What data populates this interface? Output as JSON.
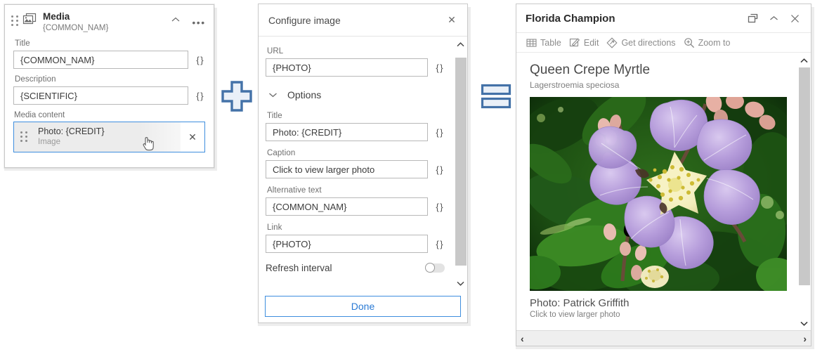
{
  "media_panel": {
    "header": {
      "icon": "media-image-icon",
      "title": "Media",
      "subtitle": "{COMMON_NAM}",
      "collapse_icon": "chevron-up-icon",
      "menu_icon": "ellipsis-icon",
      "drag_icon": "drag-handle-icon"
    },
    "fields": [
      {
        "label": "Title",
        "value": "{COMMON_NAM}",
        "expr_icon": "{ }"
      },
      {
        "label": "Description",
        "value": "{SCIENTIFIC}",
        "expr_icon": "{ }"
      }
    ],
    "media_content": {
      "label": "Media content",
      "item_title": "Photo: {CREDIT}",
      "item_subtitle": "Image",
      "remove_icon": "close-icon",
      "drag_icon": "drag-handle-icon",
      "cursor_icon": "pointer-hand-cursor",
      "selected_border_color": "#3e8ede"
    }
  },
  "operators": {
    "plus": {
      "icon": "plus-sign-glyph",
      "color": "#4472a8"
    },
    "equals": {
      "icon": "equals-sign-glyph",
      "color": "#4472a8"
    }
  },
  "configure_panel": {
    "title": "Configure image",
    "close_icon": "close-icon",
    "url_field": {
      "label": "URL",
      "value": "{PHOTO}",
      "expr_icon": "{ }"
    },
    "options_section": {
      "label": "Options",
      "chevron_icon": "chevron-down-icon",
      "expanded": true
    },
    "fields": [
      {
        "label": "Title",
        "value": "Photo: {CREDIT}",
        "expr_icon": "{ }"
      },
      {
        "label": "Caption",
        "value": "Click to view larger photo",
        "expr_icon": "{ }"
      },
      {
        "label": "Alternative text",
        "value": "{COMMON_NAM}",
        "expr_icon": "{ }"
      },
      {
        "label": "Link",
        "value": "{PHOTO}",
        "expr_icon": "{ }"
      }
    ],
    "refresh": {
      "label": "Refresh interval",
      "toggle_on": false,
      "toggle_icon": "switch-toggle-off"
    },
    "scrollbar": {
      "up_icon": "scroll-up-arrow",
      "down_icon": "scroll-down-arrow"
    },
    "done_label": "Done",
    "accent_color": "#2a7ad4"
  },
  "popup_panel": {
    "title": "Florida Champion",
    "header_buttons": [
      {
        "icon": "dock-windows-icon",
        "name": "dock-button"
      },
      {
        "icon": "chevron-up-icon",
        "name": "collapse-button"
      },
      {
        "icon": "close-icon",
        "name": "close-button"
      }
    ],
    "toolbar": [
      {
        "label": "Table",
        "icon": "table-icon"
      },
      {
        "label": "Edit",
        "icon": "edit-pencil-icon"
      },
      {
        "label": "Get directions",
        "icon": "directions-icon"
      },
      {
        "label": "Zoom to",
        "icon": "zoom-in-icon"
      }
    ],
    "content": {
      "heading": "Queen Crepe Myrtle",
      "subheading": "Lagerstroemia speciosa",
      "image_alt": "Queen Crepe Myrtle",
      "caption_title": "Photo: Patrick Griffith",
      "caption_sub": "Click to view larger photo"
    },
    "scrollbar": {
      "up_icon": "scroll-up-arrow",
      "down_icon": "scroll-down-arrow"
    },
    "pager": {
      "prev_icon": "prev-arrow",
      "prev_label": "‹",
      "next_icon": "next-arrow",
      "next_label": "›"
    }
  }
}
